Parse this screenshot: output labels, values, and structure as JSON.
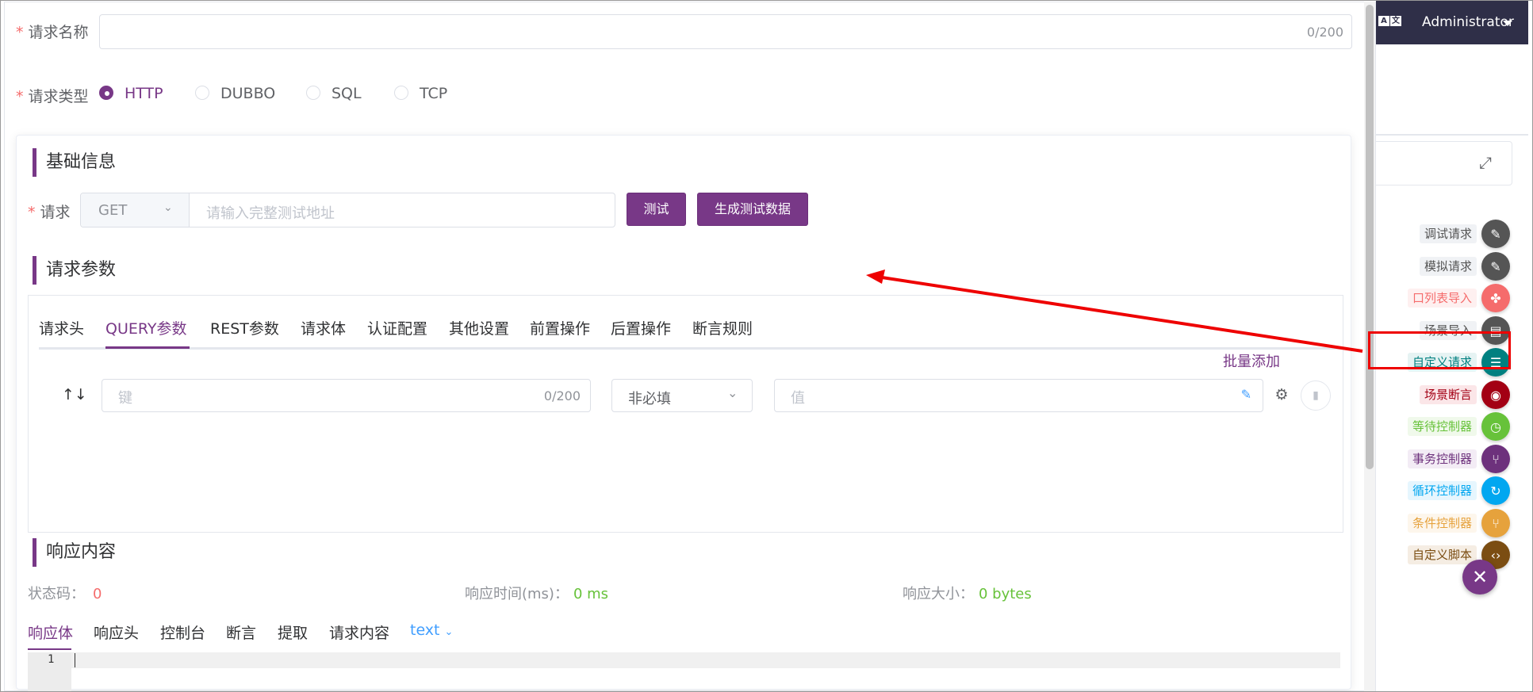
{
  "form": {
    "name_label": "请求名称",
    "name_counter": "0/200",
    "type_label": "请求类型",
    "types": [
      "HTTP",
      "DUBBO",
      "SQL",
      "TCP"
    ],
    "selected_type": "HTTP",
    "required_mark": "*"
  },
  "basic": {
    "title": "基础信息",
    "request_label": "请求",
    "method": "GET",
    "url_placeholder": "请输入完整测试地址",
    "test_button": "测试",
    "generate_button": "生成测试数据"
  },
  "params": {
    "title": "请求参数",
    "tabs": [
      "请求头",
      "QUERY参数",
      "REST参数",
      "请求体",
      "认证配置",
      "其他设置",
      "前置操作",
      "后置操作",
      "断言规则"
    ],
    "active_tab": "QUERY参数",
    "batch_add": "批量添加",
    "row": {
      "key_placeholder": "键",
      "key_counter": "0/200",
      "required_value": "非必填",
      "value_placeholder": "值"
    }
  },
  "response": {
    "title": "响应内容",
    "status_label": "状态码：",
    "status_value": "0",
    "time_label": "响应时间(ms)：",
    "time_value": "0 ms",
    "size_label": "响应大小：",
    "size_value": "0 bytes",
    "tabs": [
      "响应体",
      "响应头",
      "控制台",
      "断言",
      "提取",
      "请求内容"
    ],
    "active_tab": "响应体",
    "format": "text",
    "line_number": "1"
  },
  "topbar": {
    "user": "Administrator"
  },
  "sidebar": {
    "items": [
      {
        "label": "调试请求",
        "icon": "pipette-icon",
        "color": "#555555",
        "labelColor": "#555555",
        "labelBg": "#f0f2f5"
      },
      {
        "label": "模拟请求",
        "icon": "pipette-icon",
        "color": "#555555",
        "labelColor": "#555555",
        "labelBg": "#f0f2f5"
      },
      {
        "label": "口列表导入",
        "icon": "api-import-icon",
        "color": "#f56c6c",
        "labelColor": "#f56c6c",
        "labelBg": "#fef0f0"
      },
      {
        "label": "场景导入",
        "icon": "clapper-icon",
        "color": "#555555",
        "labelColor": "#555555",
        "labelBg": "#f0f2f5"
      },
      {
        "label": "自定义请求",
        "icon": "sliders-icon",
        "color": "#008080",
        "labelColor": "#008080",
        "labelBg": "#e6f3f3"
      },
      {
        "label": "场景断言",
        "icon": "assertion-icon",
        "color": "#a30014",
        "labelColor": "#a30014",
        "labelBg": "#fbe6e8"
      },
      {
        "label": "等待控制器",
        "icon": "clock-icon",
        "color": "#67c23a",
        "labelColor": "#67c23a",
        "labelBg": "#f0f9eb"
      },
      {
        "label": "事务控制器",
        "icon": "branch-icon",
        "color": "#6d317c",
        "labelColor": "#6d317c",
        "labelBg": "#f3ecf5"
      },
      {
        "label": "循环控制器",
        "icon": "loop-icon",
        "color": "#02a7f0",
        "labelColor": "#02a7f0",
        "labelBg": "#e6f6fe"
      },
      {
        "label": "条件控制器",
        "icon": "branch-icon",
        "color": "#e6a23c",
        "labelColor": "#e6a23c",
        "labelBg": "#fdf6ec"
      },
      {
        "label": "自定义脚本",
        "icon": "code-icon",
        "color": "#7b4d12",
        "labelColor": "#7b4d12",
        "labelBg": "#f5ede3"
      }
    ],
    "close_icon": "close-icon"
  },
  "colors": {
    "primary": "#783887",
    "annotation": "#ee0000"
  }
}
